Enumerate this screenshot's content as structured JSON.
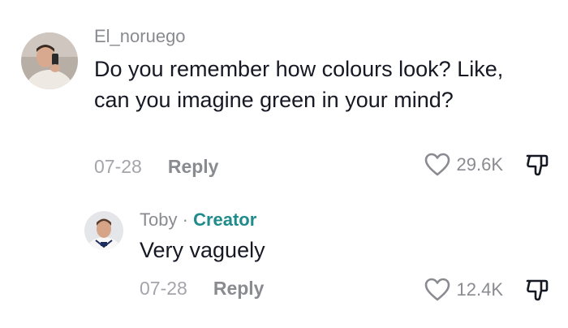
{
  "comments": [
    {
      "username": "El_noruego",
      "text": "Do you remember how colours look? Like, can you imagine green in your mind?",
      "date": "07-28",
      "reply_label": "Reply",
      "likes": "29.6K"
    },
    {
      "username": "Toby",
      "separator": "·",
      "badge": "Creator",
      "text": "Very vaguely",
      "date": "07-28",
      "reply_label": "Reply",
      "likes": "12.4K"
    }
  ],
  "icons": {
    "like": "heart-outline-icon",
    "dislike": "thumbs-down-outline-icon"
  },
  "colors": {
    "creator_badge": "#1f8b8b",
    "secondary_text": "#8a8b91"
  }
}
